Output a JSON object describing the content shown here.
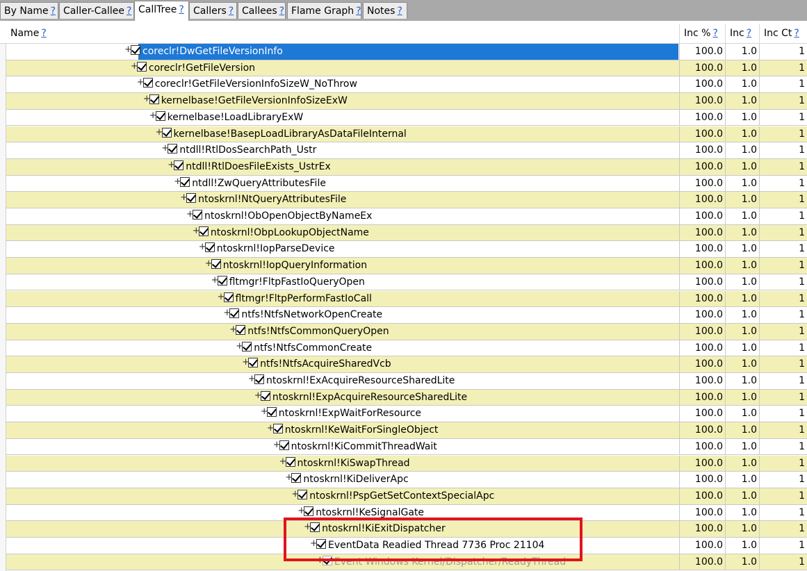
{
  "tabs": [
    {
      "label": "By Name",
      "help": "?",
      "active": false
    },
    {
      "label": "Caller-Callee",
      "help": "?",
      "active": false
    },
    {
      "label": "CallTree",
      "help": "?",
      "active": true
    },
    {
      "label": "Callers",
      "help": "?",
      "active": false
    },
    {
      "label": "Callees",
      "help": "?",
      "active": false
    },
    {
      "label": "Flame Graph",
      "help": "?",
      "active": false
    },
    {
      "label": "Notes",
      "help": "?",
      "active": false
    }
  ],
  "columns": {
    "name": "Name",
    "inc_pct": "Inc %",
    "inc": "Inc",
    "inc_ct": "Inc Ct",
    "help": "?"
  },
  "rows": [
    {
      "label": "coreclr!DwGetFileVersionInfo",
      "inc_pct": "100.0",
      "inc": "1.0",
      "inc_ct": "1"
    },
    {
      "label": "coreclr!GetFileVersion",
      "inc_pct": "100.0",
      "inc": "1.0",
      "inc_ct": "1"
    },
    {
      "label": "coreclr!GetFileVersionInfoSizeW_NoThrow",
      "inc_pct": "100.0",
      "inc": "1.0",
      "inc_ct": "1"
    },
    {
      "label": "kernelbase!GetFileVersionInfoSizeExW",
      "inc_pct": "100.0",
      "inc": "1.0",
      "inc_ct": "1"
    },
    {
      "label": "kernelbase!LoadLibraryExW",
      "inc_pct": "100.0",
      "inc": "1.0",
      "inc_ct": "1"
    },
    {
      "label": "kernelbase!BasepLoadLibraryAsDataFileInternal",
      "inc_pct": "100.0",
      "inc": "1.0",
      "inc_ct": "1"
    },
    {
      "label": "ntdll!RtlDosSearchPath_Ustr",
      "inc_pct": "100.0",
      "inc": "1.0",
      "inc_ct": "1"
    },
    {
      "label": "ntdll!RtlDoesFileExists_UstrEx",
      "inc_pct": "100.0",
      "inc": "1.0",
      "inc_ct": "1"
    },
    {
      "label": "ntdll!ZwQueryAttributesFile",
      "inc_pct": "100.0",
      "inc": "1.0",
      "inc_ct": "1"
    },
    {
      "label": "ntoskrnl!NtQueryAttributesFile",
      "inc_pct": "100.0",
      "inc": "1.0",
      "inc_ct": "1"
    },
    {
      "label": "ntoskrnl!ObOpenObjectByNameEx",
      "inc_pct": "100.0",
      "inc": "1.0",
      "inc_ct": "1"
    },
    {
      "label": "ntoskrnl!ObpLookupObjectName",
      "inc_pct": "100.0",
      "inc": "1.0",
      "inc_ct": "1"
    },
    {
      "label": "ntoskrnl!IopParseDevice",
      "inc_pct": "100.0",
      "inc": "1.0",
      "inc_ct": "1"
    },
    {
      "label": "ntoskrnl!IopQueryInformation",
      "inc_pct": "100.0",
      "inc": "1.0",
      "inc_ct": "1"
    },
    {
      "label": "fltmgr!FltpFastIoQueryOpen",
      "inc_pct": "100.0",
      "inc": "1.0",
      "inc_ct": "1"
    },
    {
      "label": "fltmgr!FltpPerformFastIoCall",
      "inc_pct": "100.0",
      "inc": "1.0",
      "inc_ct": "1"
    },
    {
      "label": "ntfs!NtfsNetworkOpenCreate",
      "inc_pct": "100.0",
      "inc": "1.0",
      "inc_ct": "1"
    },
    {
      "label": "ntfs!NtfsCommonQueryOpen",
      "inc_pct": "100.0",
      "inc": "1.0",
      "inc_ct": "1"
    },
    {
      "label": "ntfs!NtfsCommonCreate",
      "inc_pct": "100.0",
      "inc": "1.0",
      "inc_ct": "1"
    },
    {
      "label": "ntfs!NtfsAcquireSharedVcb",
      "inc_pct": "100.0",
      "inc": "1.0",
      "inc_ct": "1"
    },
    {
      "label": "ntoskrnl!ExAcquireResourceSharedLite",
      "inc_pct": "100.0",
      "inc": "1.0",
      "inc_ct": "1"
    },
    {
      "label": "ntoskrnl!ExpAcquireResourceSharedLite",
      "inc_pct": "100.0",
      "inc": "1.0",
      "inc_ct": "1"
    },
    {
      "label": "ntoskrnl!ExpWaitForResource",
      "inc_pct": "100.0",
      "inc": "1.0",
      "inc_ct": "1"
    },
    {
      "label": "ntoskrnl!KeWaitForSingleObject",
      "inc_pct": "100.0",
      "inc": "1.0",
      "inc_ct": "1"
    },
    {
      "label": "ntoskrnl!KiCommitThreadWait",
      "inc_pct": "100.0",
      "inc": "1.0",
      "inc_ct": "1"
    },
    {
      "label": "ntoskrnl!KiSwapThread",
      "inc_pct": "100.0",
      "inc": "1.0",
      "inc_ct": "1"
    },
    {
      "label": "ntoskrnl!KiDeliverApc",
      "inc_pct": "100.0",
      "inc": "1.0",
      "inc_ct": "1"
    },
    {
      "label": "ntoskrnl!PspGetSetContextSpecialApc",
      "inc_pct": "100.0",
      "inc": "1.0",
      "inc_ct": "1"
    },
    {
      "label": "ntoskrnl!KeSignalGate",
      "inc_pct": "100.0",
      "inc": "1.0",
      "inc_ct": "1"
    },
    {
      "label": "ntoskrnl!KiExitDispatcher",
      "inc_pct": "100.0",
      "inc": "1.0",
      "inc_ct": "1"
    },
    {
      "label": "EventData Readied Thread 7736 Proc 21104",
      "inc_pct": "100.0",
      "inc": "1.0",
      "inc_ct": "1"
    },
    {
      "label": "Event Windows Kernel/Dispatcher/ReadyThread",
      "inc_pct": "100.0",
      "inc": "1.0",
      "inc_ct": "1"
    }
  ],
  "colors": {
    "row_alt": "#f2f0b6",
    "selected": "#1e78d6",
    "annotation": "#e0141c",
    "help_link": "#1f5fd0"
  },
  "icons": {
    "expand": "plus-icon",
    "check": "checkbox-checked-icon"
  }
}
